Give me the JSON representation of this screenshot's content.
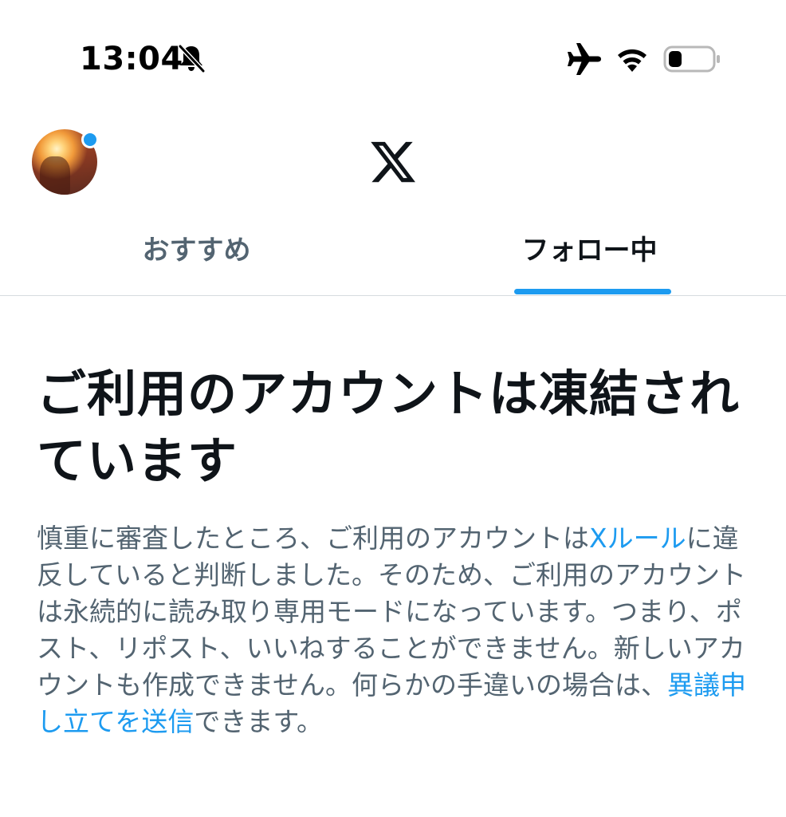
{
  "status_bar": {
    "time": "13:04",
    "icons": [
      "bell-slash-icon",
      "airplane-icon",
      "wifi-icon",
      "battery-icon"
    ]
  },
  "header": {
    "logo": "X",
    "avatar_has_notification": true
  },
  "tabs": [
    {
      "label": "おすすめ",
      "active": false
    },
    {
      "label": "フォロー中",
      "active": true
    }
  ],
  "notice": {
    "title": "ご利用のアカウントは凍結されています",
    "body_part1": "慎重に審査したところ、ご利用のアカウントは",
    "rules_link": "Xルール",
    "body_part2": "に違反していると判断しました。そのため、ご利用のアカウントは永続的に読み取り専用モードになっています。つまり、ポスト、リポスト、いいねすることができません。新しいアカウントも作成できません。何らかの手違いの場合は、",
    "appeal_link": "異議申し立てを送信",
    "body_part3": "できます。"
  },
  "colors": {
    "accent": "#1d9bf0",
    "text_primary": "#0f1419",
    "text_secondary": "#536471",
    "divider": "#d6dbdf"
  }
}
